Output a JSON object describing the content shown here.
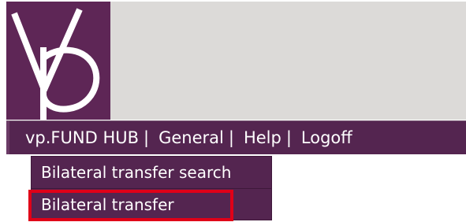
{
  "logo": {
    "icon": "vp-logo-icon",
    "background_color": "#5e2656",
    "stroke_color": "#ffffff"
  },
  "header": {
    "background_color": "#dcdad8"
  },
  "nav": {
    "background_color": "#542550",
    "items": [
      {
        "label": "vp.FUND HUB",
        "separator": "|"
      },
      {
        "label": "General",
        "separator": "|"
      },
      {
        "label": "Help",
        "separator": "|"
      },
      {
        "label": "Logoff"
      }
    ]
  },
  "dropdown": {
    "items": [
      {
        "label": "Bilateral transfer search"
      },
      {
        "label": "Bilateral transfer",
        "highlighted": true
      }
    ]
  },
  "annotation": {
    "highlight_color": "#e00018"
  }
}
